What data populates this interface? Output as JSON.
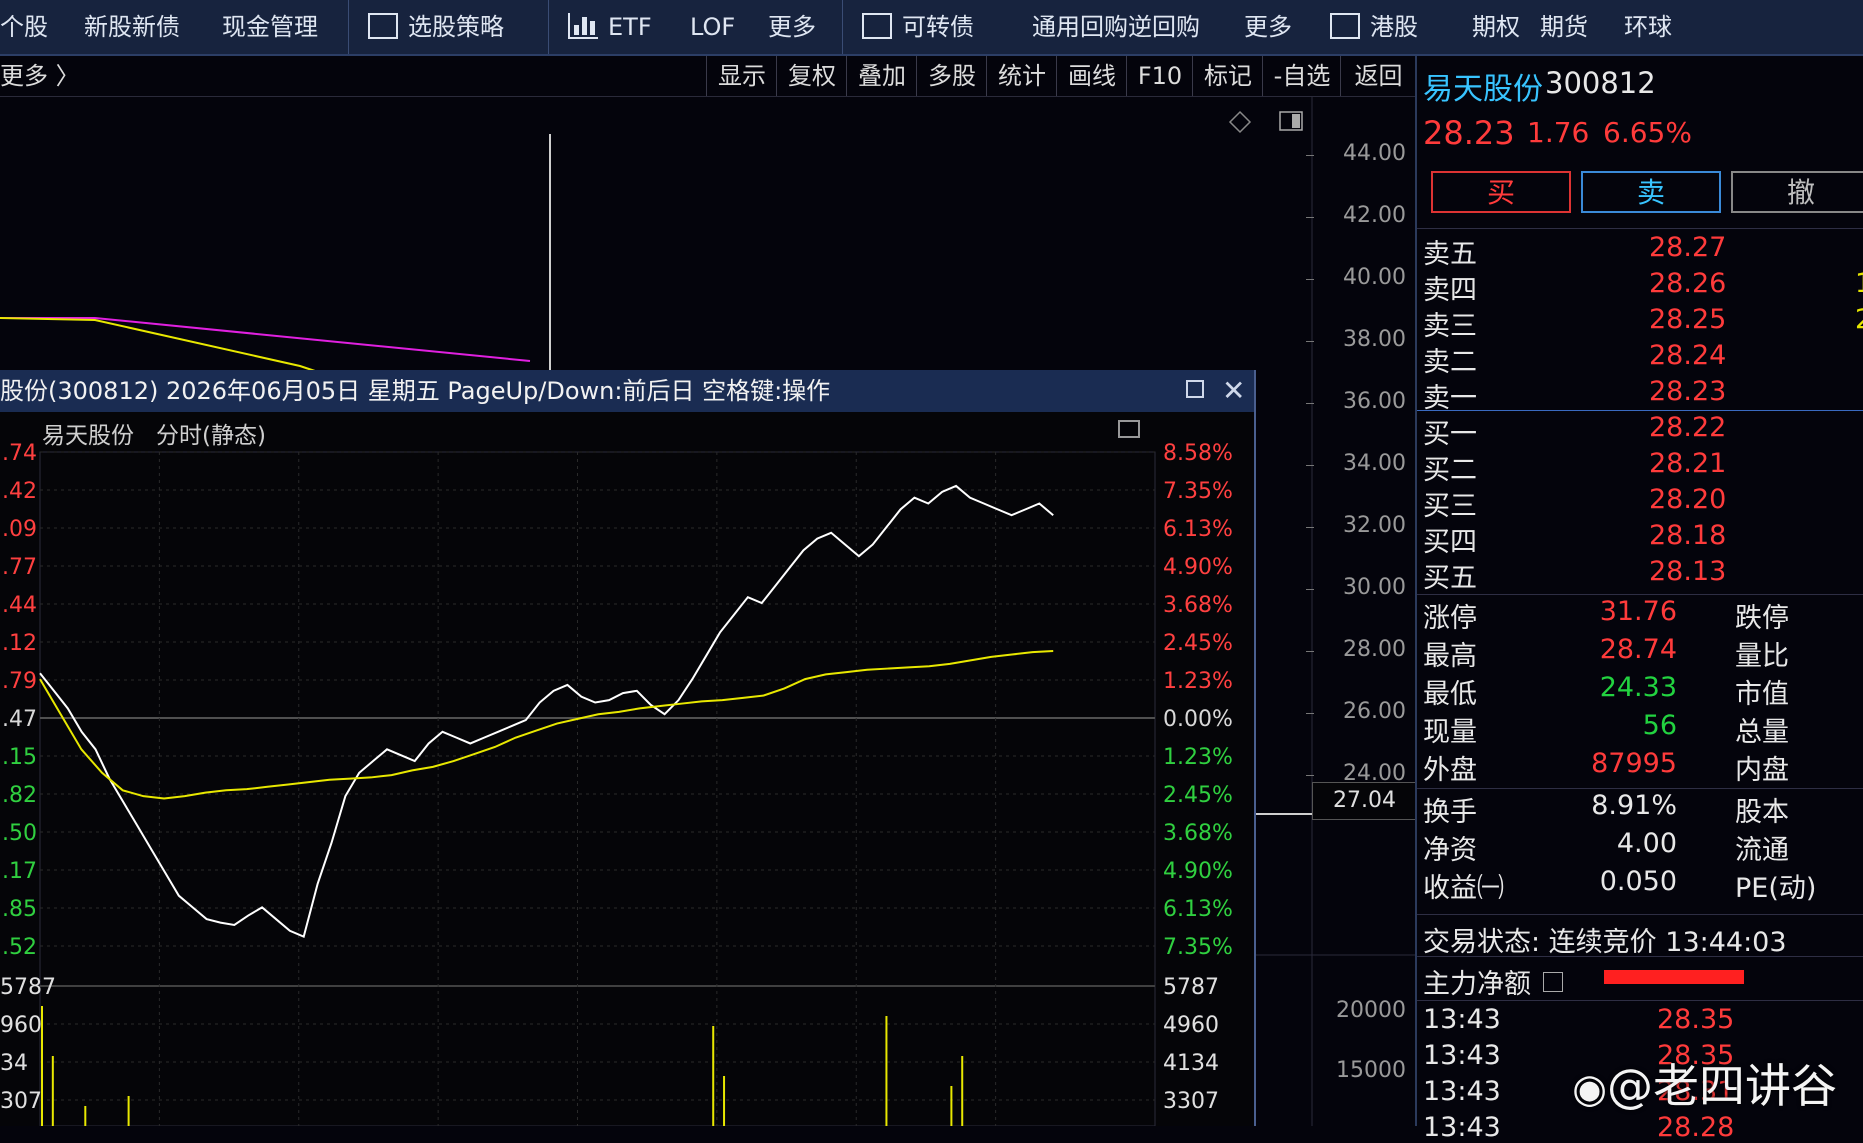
{
  "nav": {
    "items": [
      "个股",
      "新股新债",
      "现金管理",
      "选股策略",
      "ETF",
      "LOF",
      "更多",
      "可转债",
      "通用回购逆回购",
      "更多",
      "港股",
      "期权",
      "期货",
      "环球"
    ]
  },
  "toolbar": {
    "more_label": "更多 〉",
    "buttons": [
      "显示",
      "复权",
      "叠加",
      "多股",
      "统计",
      "画线",
      "F10",
      "标记",
      "-自选",
      "返回"
    ]
  },
  "kline": {
    "price_axis": [
      "44.00",
      "42.00",
      "40.00",
      "38.00",
      "36.00",
      "34.00",
      "32.00",
      "30.00",
      "28.00",
      "26.00",
      "24.00"
    ],
    "current_price_label": "27.04",
    "volume_axis": [
      "20000",
      "15000"
    ],
    "colors": {
      "ma_magenta": "#e020e0",
      "ma_yellow": "#e8e800"
    }
  },
  "popup": {
    "title": "股份(300812) 2026年06月05日 星期五 PageUp/Down:前后日 空格键:操作",
    "stock_name": "易天股份",
    "mode_label": "分时(静态)",
    "left_axis": [
      ".74",
      ".42",
      ".09",
      ".77",
      ".44",
      ".12",
      ".79",
      ".47",
      ".15",
      ".82",
      ".50",
      ".17",
      ".85",
      ".52"
    ],
    "right_axis": [
      "8.58%",
      "7.35%",
      "6.13%",
      "4.90%",
      "3.68%",
      "2.45%",
      "1.23%",
      "0.00%",
      "1.23%",
      "2.45%",
      "3.68%",
      "4.90%",
      "6.13%",
      "7.35%"
    ],
    "volume_left_axis": [
      "5787",
      "960",
      "34",
      "307"
    ],
    "volume_right_axis": [
      "5787",
      "4960",
      "4134",
      "3307"
    ],
    "line_colors": {
      "price": "#ffffff",
      "avg": "#e8e800",
      "volume": "#e8e800"
    }
  },
  "chart_data": {
    "type": "line",
    "title": "易天股份 分时(静态)",
    "xlabel": "",
    "ylabel": "",
    "ylim": [
      24.52,
      28.74
    ],
    "series": [
      {
        "name": "price",
        "values": [
          26.85,
          26.7,
          26.55,
          26.35,
          26.2,
          25.95,
          25.75,
          25.55,
          25.35,
          25.15,
          24.95,
          24.85,
          24.75,
          24.72,
          24.7,
          24.78,
          24.85,
          24.75,
          24.65,
          24.6,
          25.05,
          25.4,
          25.8,
          26.0,
          26.1,
          26.2,
          26.15,
          26.1,
          26.25,
          26.35,
          26.3,
          26.25,
          26.3,
          26.35,
          26.4,
          26.45,
          26.6,
          26.7,
          26.75,
          26.65,
          26.6,
          26.62,
          26.68,
          26.7,
          26.58,
          26.5,
          26.62,
          26.8,
          27.0,
          27.2,
          27.35,
          27.5,
          27.45,
          27.6,
          27.75,
          27.9,
          28.0,
          28.05,
          27.95,
          27.85,
          27.95,
          28.1,
          28.25,
          28.35,
          28.3,
          28.4,
          28.45,
          28.35,
          28.3,
          28.25,
          28.2,
          28.25,
          28.3,
          28.2
        ],
        "note": ""
      },
      {
        "name": "avg",
        "values": [
          26.8,
          26.5,
          26.2,
          26.0,
          25.85,
          25.8,
          25.78,
          25.8,
          25.83,
          25.85,
          25.86,
          25.88,
          25.9,
          25.92,
          25.94,
          25.95,
          25.96,
          25.98,
          26.02,
          26.05,
          26.1,
          26.16,
          26.22,
          26.3,
          26.36,
          26.42,
          26.46,
          26.5,
          26.52,
          26.55,
          26.57,
          26.59,
          26.61,
          26.62,
          26.64,
          26.66,
          26.72,
          26.8,
          26.84,
          26.86,
          26.88,
          26.89,
          26.9,
          26.91,
          26.93,
          26.96,
          26.99,
          27.01,
          27.03,
          27.04
        ]
      }
    ],
    "pct_range": [
      "-8.58%",
      "8.58%"
    ],
    "prev_close": 27.47
  },
  "quote": {
    "name": "易天股份",
    "code": "300812",
    "price": "28.23",
    "change": "1.76",
    "change_pct": "6.65%",
    "buy_label": "买",
    "sell_label": "卖",
    "cancel_label": "撤",
    "asks": [
      {
        "label": "卖五",
        "price": "28.27",
        "vol": ""
      },
      {
        "label": "卖四",
        "price": "28.26",
        "vol": "1"
      },
      {
        "label": "卖三",
        "price": "28.25",
        "vol": "2"
      },
      {
        "label": "卖二",
        "price": "28.24",
        "vol": ""
      },
      {
        "label": "卖一",
        "price": "28.23",
        "vol": ""
      }
    ],
    "bids": [
      {
        "label": "买一",
        "price": "28.22"
      },
      {
        "label": "买二",
        "price": "28.21"
      },
      {
        "label": "买三",
        "price": "28.20"
      },
      {
        "label": "买四",
        "price": "28.18"
      },
      {
        "label": "买五",
        "price": "28.13"
      }
    ],
    "stats": [
      {
        "label": "涨停",
        "value": "31.76",
        "value_color": "red",
        "label2": "跌停"
      },
      {
        "label": "最高",
        "value": "28.74",
        "value_color": "red",
        "label2": "量比"
      },
      {
        "label": "最低",
        "value": "24.33",
        "value_color": "green",
        "label2": "市值"
      },
      {
        "label": "现量",
        "value": "56",
        "value_color": "green",
        "label2": "总量"
      },
      {
        "label": "外盘",
        "value": "87995",
        "value_color": "red",
        "label2": "内盘"
      }
    ],
    "fundamentals": [
      {
        "label": "换手",
        "value": "8.91%",
        "label2": "股本"
      },
      {
        "label": "净资",
        "value": "4.00",
        "label2": "流通"
      },
      {
        "label": "收益㈠",
        "value": "0.050",
        "label2": "PE(动)"
      }
    ],
    "trade_status": "交易状态: 连续竞价 13:44:03",
    "main_flow_label": "主力净额",
    "ticks": [
      {
        "time": "13:43",
        "price": "28.35"
      },
      {
        "time": "13:43",
        "price": "28.35"
      },
      {
        "time": "13:43",
        "price": "28.31"
      },
      {
        "time": "13:43",
        "price": "28.28"
      }
    ]
  },
  "watermark": "@老四讲谷"
}
